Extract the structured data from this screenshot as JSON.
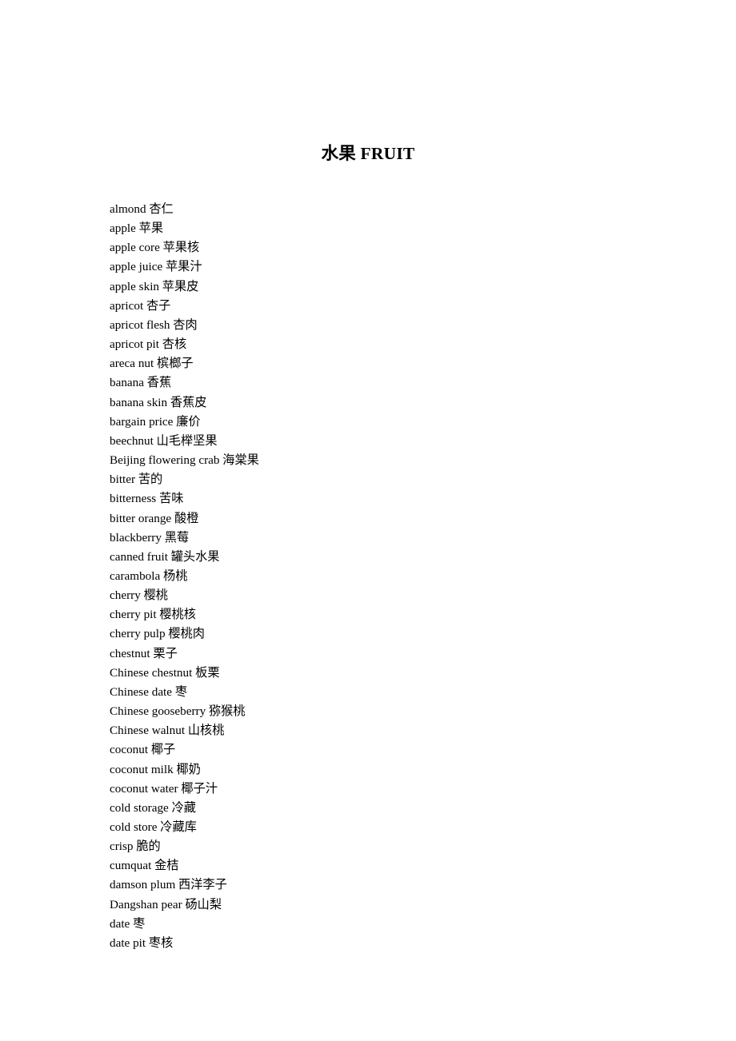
{
  "document": {
    "title": "水果 FRUIT",
    "title_chinese": "水果",
    "title_english": "FRUIT"
  },
  "glossary": {
    "entries": [
      {
        "term": "almond",
        "gloss": "杏仁",
        "text": "almond 杏仁"
      },
      {
        "term": "apple",
        "gloss": "苹果",
        "text": "apple 苹果"
      },
      {
        "term": "apple core",
        "gloss": "苹果核",
        "text": "apple core 苹果核"
      },
      {
        "term": "apple juice",
        "gloss": "苹果汁",
        "text": "apple juice 苹果汁"
      },
      {
        "term": "apple skin",
        "gloss": "苹果皮",
        "text": "apple skin 苹果皮"
      },
      {
        "term": "apricot",
        "gloss": "杏子",
        "text": "apricot 杏子"
      },
      {
        "term": "apricot flesh",
        "gloss": "杏肉",
        "text": "apricot flesh 杏肉"
      },
      {
        "term": "apricot pit",
        "gloss": "杏核",
        "text": "apricot pit 杏核"
      },
      {
        "term": "areca nut",
        "gloss": "槟榔子",
        "text": "areca nut 槟榔子"
      },
      {
        "term": "banana",
        "gloss": "香蕉",
        "text": "banana 香蕉"
      },
      {
        "term": "banana skin",
        "gloss": "香蕉皮",
        "text": "banana skin 香蕉皮"
      },
      {
        "term": "bargain price",
        "gloss": "廉价",
        "text": "bargain price 廉价"
      },
      {
        "term": "beechnut",
        "gloss": "山毛榉坚果",
        "text": "beechnut 山毛榉坚果"
      },
      {
        "term": "Beijing flowering crab",
        "gloss": "海棠果",
        "text": "Beijing flowering crab 海棠果"
      },
      {
        "term": "bitter",
        "gloss": "苦的",
        "text": "bitter 苦的"
      },
      {
        "term": "bitterness",
        "gloss": "苦味",
        "text": "bitterness 苦味"
      },
      {
        "term": "bitter orange",
        "gloss": "酸橙",
        "text": "bitter orange 酸橙"
      },
      {
        "term": "blackberry",
        "gloss": "黑莓",
        "text": "blackberry 黑莓"
      },
      {
        "term": "canned fruit",
        "gloss": "罐头水果",
        "text": "canned fruit 罐头水果"
      },
      {
        "term": "carambola",
        "gloss": "杨桃",
        "text": "carambola 杨桃"
      },
      {
        "term": "cherry",
        "gloss": "樱桃",
        "text": "cherry 樱桃"
      },
      {
        "term": "cherry pit",
        "gloss": "樱桃核",
        "text": "cherry pit 樱桃核"
      },
      {
        "term": "cherry pulp",
        "gloss": "樱桃肉",
        "text": "cherry pulp 樱桃肉"
      },
      {
        "term": "chestnut",
        "gloss": "栗子",
        "text": "chestnut 栗子"
      },
      {
        "term": "Chinese chestnut",
        "gloss": "板栗",
        "text": "Chinese chestnut 板栗"
      },
      {
        "term": "Chinese date",
        "gloss": "枣",
        "text": "Chinese date 枣"
      },
      {
        "term": "Chinese gooseberry",
        "gloss": "猕猴桃",
        "text": "Chinese gooseberry 猕猴桃"
      },
      {
        "term": "Chinese walnut",
        "gloss": "山核桃",
        "text": "Chinese walnut 山核桃"
      },
      {
        "term": "coconut",
        "gloss": "椰子",
        "text": "coconut 椰子"
      },
      {
        "term": "coconut milk",
        "gloss": "椰奶",
        "text": "coconut milk 椰奶"
      },
      {
        "term": "coconut water",
        "gloss": "椰子汁",
        "text": "coconut water 椰子汁"
      },
      {
        "term": "cold storage",
        "gloss": "冷藏",
        "text": "cold storage 冷藏"
      },
      {
        "term": "cold store",
        "gloss": "冷藏库",
        "text": "cold store 冷藏库"
      },
      {
        "term": "crisp",
        "gloss": "脆的",
        "text": "crisp 脆的"
      },
      {
        "term": "cumquat",
        "gloss": "金桔",
        "text": "cumquat 金桔"
      },
      {
        "term": "damson plum",
        "gloss": "西洋李子",
        "text": "damson plum 西洋李子"
      },
      {
        "term": "Dangshan pear",
        "gloss": "砀山梨",
        "text": "Dangshan pear 砀山梨"
      },
      {
        "term": "date",
        "gloss": "枣",
        "text": "date 枣"
      },
      {
        "term": "date pit",
        "gloss": "枣核",
        "text": "date pit 枣核"
      }
    ]
  }
}
